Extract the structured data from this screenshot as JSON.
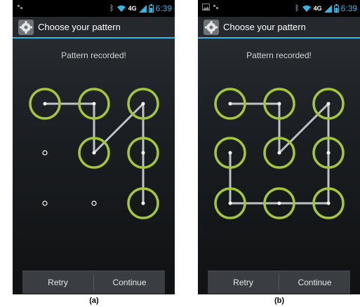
{
  "panels": [
    {
      "status": {
        "time": "6:39",
        "network": "4G"
      },
      "title": "Choose your pattern",
      "headline": "Pattern recorded!",
      "retry_label": "Retry",
      "continue_label": "Continue",
      "caption": "(a)",
      "selected": [
        0,
        1,
        4,
        2,
        5,
        8
      ]
    },
    {
      "status": {
        "time": "6:39",
        "network": "4G"
      },
      "title": "Choose your pattern",
      "headline": "Pattern recorded!",
      "retry_label": "Retry",
      "continue_label": "Continue",
      "caption": "(b)",
      "selected": [
        0,
        1,
        4,
        2,
        5,
        8,
        7,
        6,
        3
      ]
    }
  ],
  "colors": {
    "accent": "#33b5e5",
    "ring": "#a4c639",
    "line": "#bfc3c6"
  },
  "icons": [
    "settings-gear-icon",
    "bluetooth-icon",
    "wifi-icon",
    "signal-icon",
    "battery-icon",
    "image-icon",
    "notification-icon"
  ]
}
